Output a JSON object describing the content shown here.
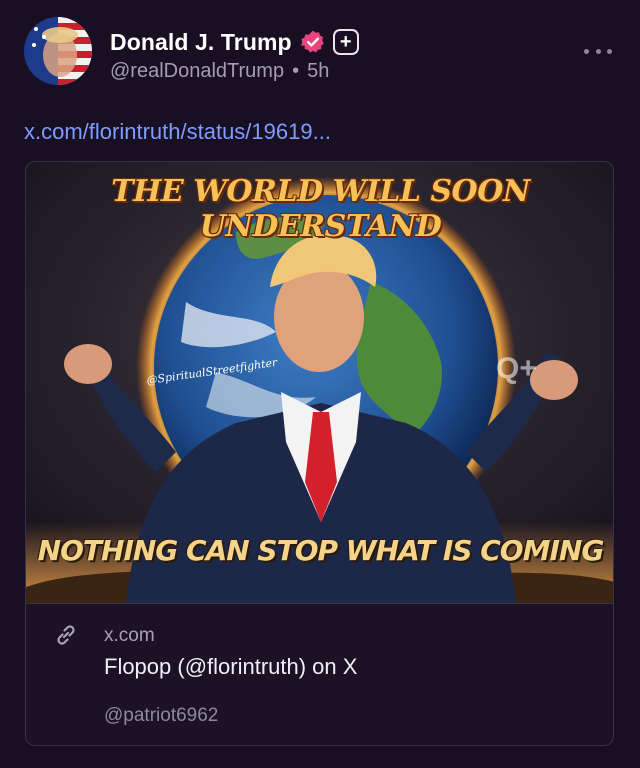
{
  "post": {
    "display_name": "Donald J. Trump",
    "handle": "@realDonaldTrump",
    "separator": "•",
    "time_ago": "5h",
    "follow_symbol": "+",
    "link_text": "x.com/florintruth/status/19619..."
  },
  "card": {
    "image_text_top": "THE WORLD WILL SOON UNDERSTAND",
    "image_text_bottom": "NOTHING CAN STOP WHAT IS COMING",
    "image_watermark": "@SpiritualStreetfighter",
    "image_logo": "Q+",
    "domain": "x.com",
    "title": "Flopop (@florintruth) on X",
    "handle": "@patriot6962"
  },
  "icons": {
    "verified": "verified-badge-icon",
    "follow": "plus-icon",
    "more": "more-horizontal-icon",
    "link": "link-icon"
  },
  "colors": {
    "background": "#181022",
    "link": "#7f9bff",
    "verified": "#e8457e",
    "muted_text": "#a49db0"
  }
}
